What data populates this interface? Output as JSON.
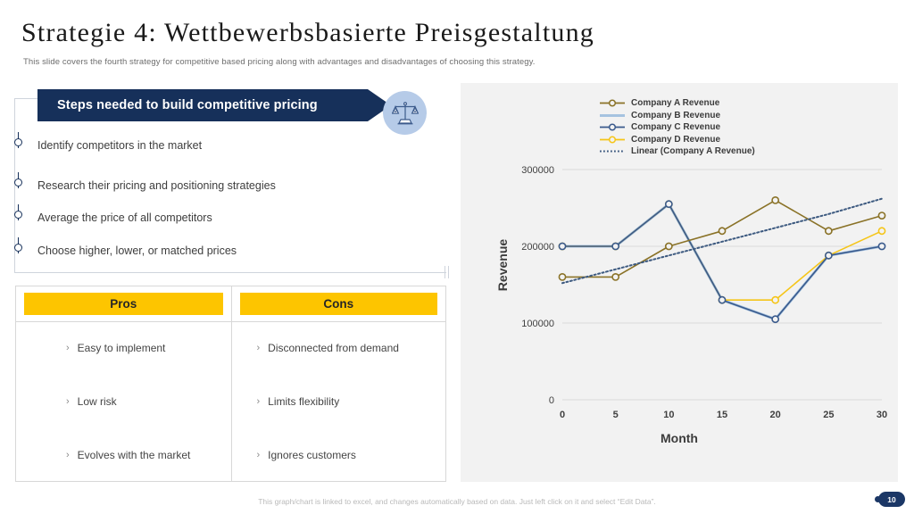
{
  "header": {
    "title": "Strategie 4: Wettbewerbsbasierte Preisgestaltung",
    "subtitle": "This slide covers the fourth strategy for competitive based pricing along with advantages and disadvantages of choosing this strategy."
  },
  "steps_section": {
    "banner_label": "Steps needed to build competitive pricing",
    "icon": "balance-scales-icon",
    "items": [
      "Identify competitors in the market",
      "Research their pricing and positioning strategies",
      "Average the price of all competitors",
      "Choose higher, lower, or matched prices"
    ]
  },
  "proscons": {
    "pros_header": "Pros",
    "cons_header": "Cons",
    "bullet": "›",
    "pros": [
      "Easy to implement",
      "Low risk",
      "Evolves with the market"
    ],
    "cons": [
      "Disconnected from demand",
      "Limits flexibility",
      "Ignores customers"
    ]
  },
  "colors": {
    "banner_navy": "#16305a",
    "header_yellow": "#fdc500",
    "icon_circle_blue": "#b6cbe8",
    "company_a": "#8a7227",
    "company_b": "#a6c3e0",
    "company_c": "#3a5a8c",
    "company_d": "#f5c518",
    "trend": "#3d5a80",
    "chart_bg": "#f2f2f2"
  },
  "chart_data": {
    "type": "line",
    "title": "",
    "xlabel": "Month",
    "ylabel": "Revenue",
    "x": [
      0,
      5,
      10,
      15,
      20,
      25,
      30
    ],
    "xticks": [
      "0",
      "5",
      "10",
      "15",
      "20",
      "25",
      "30"
    ],
    "yticks": [
      "0",
      "100000",
      "200000",
      "300000"
    ],
    "ylim": [
      0,
      300000
    ],
    "xlim": [
      0,
      30
    ],
    "grid": "horizontal",
    "legend_position": "top-center",
    "series": [
      {
        "name": "Company A Revenue",
        "color": "#8a7227",
        "marker": "circle",
        "style": "solid",
        "values": [
          160000,
          160000,
          200000,
          220000,
          260000,
          220000,
          240000
        ]
      },
      {
        "name": "Company B Revenue",
        "color": "#a6c3e0",
        "marker": "none",
        "style": "solid",
        "values": [
          200000,
          200000,
          255000,
          130000,
          105000,
          188000,
          200000
        ]
      },
      {
        "name": "Company C Revenue",
        "color": "#3a5a8c",
        "marker": "circle",
        "style": "solid",
        "values": [
          200000,
          200000,
          255000,
          130000,
          105000,
          188000,
          200000
        ]
      },
      {
        "name": "Company D Revenue",
        "color": "#f5c518",
        "marker": "circle",
        "style": "solid",
        "values": [
          200000,
          200000,
          255000,
          130000,
          130000,
          188000,
          220000
        ]
      },
      {
        "name": "Linear (Company A Revenue)",
        "color": "#3d5a80",
        "marker": "none",
        "style": "dotted",
        "trendline_of": "Company A Revenue",
        "values": [
          152000,
          170000,
          188000,
          206000,
          224000,
          242000,
          262000
        ]
      }
    ]
  },
  "footer": {
    "note": "This graph/chart is linked to excel, and changes automatically based on data. Just left click on it and select “Edit Data”.",
    "page_number": "10"
  }
}
